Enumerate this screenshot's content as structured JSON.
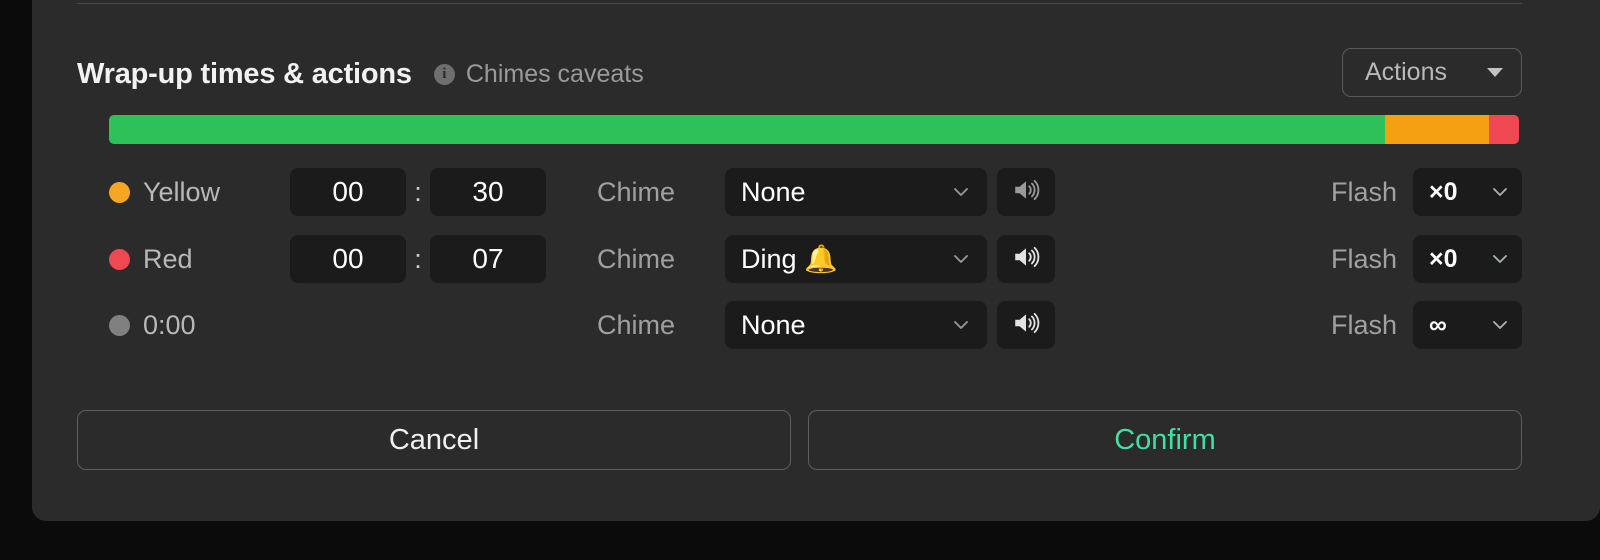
{
  "panel": {
    "title": "Wrap-up times & actions",
    "info_icon": "info-icon",
    "caveats_link": "Chimes caveats",
    "actions_button": "Actions",
    "actions_chevron": "chevron-down-icon"
  },
  "progress_bar": {
    "segments": [
      {
        "name": "green",
        "color": "#2ec159",
        "percent": 90.5
      },
      {
        "name": "orange",
        "color": "#f5a012",
        "percent": 7.4
      },
      {
        "name": "red",
        "color": "#ef4850",
        "percent": 2.1
      }
    ]
  },
  "colors": {
    "yellow_dot": "#f5a623",
    "red_dot": "#ef4850",
    "gray_dot": "#808080",
    "confirm_green": "#3fe0a0",
    "panel_bg": "#2b2b2b",
    "field_bg": "#1b1b1b"
  },
  "rows": [
    {
      "dot_color": "#f5a623",
      "level_label": "Yellow",
      "has_time": true,
      "minutes": "00",
      "colon": ":",
      "seconds": "30",
      "chime_label": "Chime",
      "chime_value": "None",
      "speaker_icon": "speaker-icon",
      "flash_label": "Flash",
      "flash_value": "×0"
    },
    {
      "dot_color": "#ef4850",
      "level_label": "Red",
      "has_time": true,
      "minutes": "00",
      "colon": ":",
      "seconds": "07",
      "chime_label": "Chime",
      "chime_value": "Ding 🔔",
      "speaker_icon": "speaker-icon",
      "flash_label": "Flash",
      "flash_value": "×0"
    },
    {
      "dot_color": "#808080",
      "level_label": "0:00",
      "has_time": false,
      "minutes": "",
      "colon": "",
      "seconds": "",
      "chime_label": "Chime",
      "chime_value": "None",
      "speaker_icon": "speaker-icon",
      "flash_label": "Flash",
      "flash_value": "∞"
    }
  ],
  "footer": {
    "cancel_label": "Cancel",
    "confirm_label": "Confirm"
  }
}
